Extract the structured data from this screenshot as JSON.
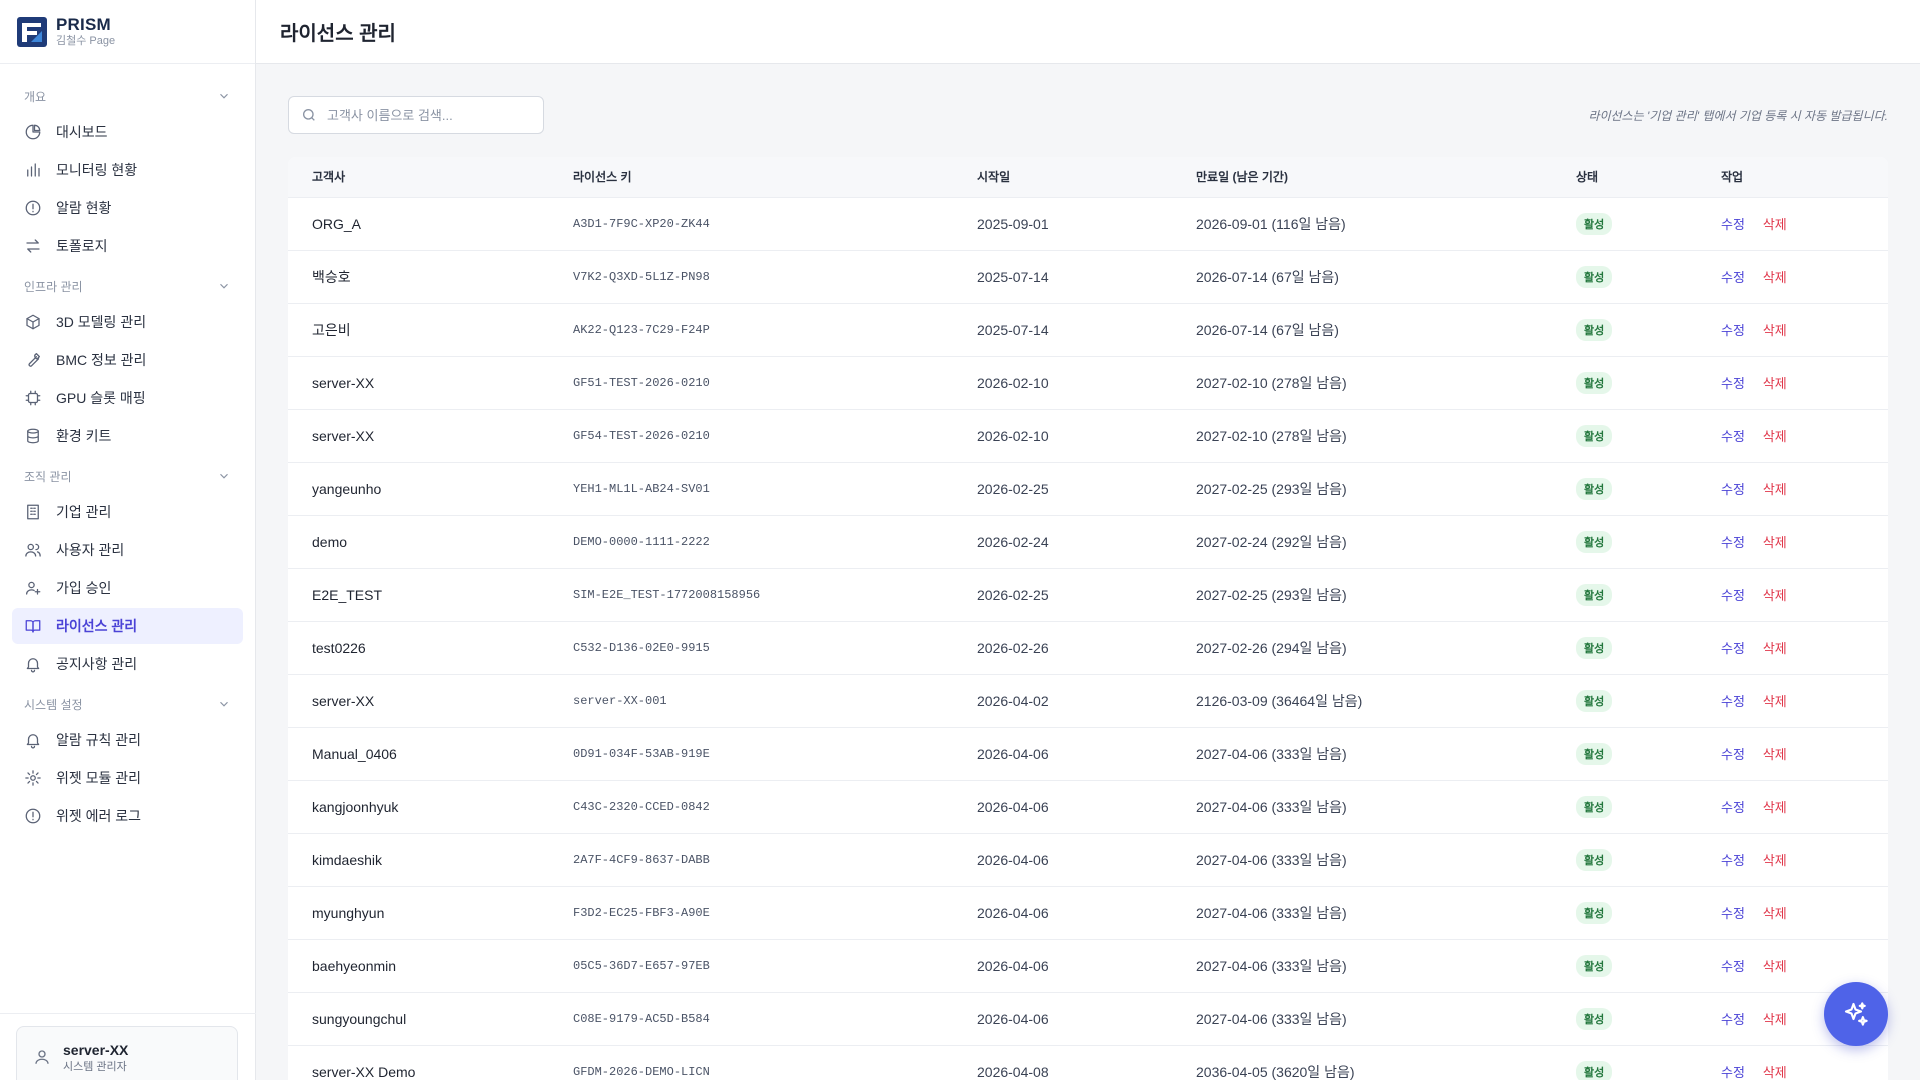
{
  "brand": {
    "name": "PRISM",
    "sub": "김철수 Page"
  },
  "header": {
    "title": "라이선스 관리"
  },
  "sidebar": {
    "sections": [
      {
        "label": "개요",
        "items": [
          {
            "label": "대시보드",
            "icon": "pie-chart-icon"
          },
          {
            "label": "모니터링 현황",
            "icon": "bar-chart-icon"
          },
          {
            "label": "알람 현황",
            "icon": "alert-circle-icon"
          },
          {
            "label": "토폴로지",
            "icon": "arrows-swap-icon"
          }
        ]
      },
      {
        "label": "인프라 관리",
        "items": [
          {
            "label": "3D 모델링 관리",
            "icon": "cube-icon"
          },
          {
            "label": "BMC 정보 관리",
            "icon": "wrench-icon"
          },
          {
            "label": "GPU 슬롯 매핑",
            "icon": "chip-icon"
          },
          {
            "label": "환경 키트",
            "icon": "database-icon"
          }
        ]
      },
      {
        "label": "조직 관리",
        "items": [
          {
            "label": "기업 관리",
            "icon": "building-icon"
          },
          {
            "label": "사용자 관리",
            "icon": "users-icon"
          },
          {
            "label": "가입 승인",
            "icon": "user-plus-icon"
          },
          {
            "label": "라이선스 관리",
            "icon": "book-open-icon",
            "active": true
          },
          {
            "label": "공지사항 관리",
            "icon": "bell-icon"
          }
        ]
      },
      {
        "label": "시스템 설정",
        "items": [
          {
            "label": "알람 규칙 관리",
            "icon": "bell-icon"
          },
          {
            "label": "위젯 모듈 관리",
            "icon": "gear-icon"
          },
          {
            "label": "위젯 에러 로그",
            "icon": "alert-circle-icon"
          }
        ]
      }
    ]
  },
  "user": {
    "name": "server-XX",
    "role": "시스템 관리자"
  },
  "search": {
    "placeholder": "고객사 이름으로 검색..."
  },
  "hint": "라이선스는 '기업 관리' 탭에서 기업 등록 시 자동 발급됩니다.",
  "table": {
    "headers": {
      "customer": "고객사",
      "key": "라이선스 키",
      "start": "시작일",
      "expiry": "만료일 (남은 기간)",
      "status": "상태",
      "action": "작업"
    },
    "edit_label": "수정",
    "delete_label": "삭제",
    "rows": [
      {
        "customer": "ORG_A",
        "key": "A3D1-7F9C-XP20-ZK44",
        "start": "2025-09-01",
        "expiry": "2026-09-01 (116일 남음)",
        "status": "활성"
      },
      {
        "customer": "백승호",
        "key": "V7K2-Q3XD-5L1Z-PN98",
        "start": "2025-07-14",
        "expiry": "2026-07-14 (67일 남음)",
        "status": "활성"
      },
      {
        "customer": "고은비",
        "key": "AK22-Q123-7C29-F24P",
        "start": "2025-07-14",
        "expiry": "2026-07-14 (67일 남음)",
        "status": "활성"
      },
      {
        "customer": "server-XX",
        "key": "GF51-TEST-2026-0210",
        "start": "2026-02-10",
        "expiry": "2027-02-10 (278일 남음)",
        "status": "활성"
      },
      {
        "customer": "server-XX",
        "key": "GF54-TEST-2026-0210",
        "start": "2026-02-10",
        "expiry": "2027-02-10 (278일 남음)",
        "status": "활성"
      },
      {
        "customer": "yangeunho",
        "key": "YEH1-ML1L-AB24-SV01",
        "start": "2026-02-25",
        "expiry": "2027-02-25 (293일 남음)",
        "status": "활성"
      },
      {
        "customer": "demo",
        "key": "DEMO-0000-1111-2222",
        "start": "2026-02-24",
        "expiry": "2027-02-24 (292일 남음)",
        "status": "활성"
      },
      {
        "customer": "E2E_TEST",
        "key": "SIM-E2E_TEST-1772008158956",
        "start": "2026-02-25",
        "expiry": "2027-02-25 (293일 남음)",
        "status": "활성"
      },
      {
        "customer": "test0226",
        "key": "C532-D136-02E0-9915",
        "start": "2026-02-26",
        "expiry": "2027-02-26 (294일 남음)",
        "status": "활성"
      },
      {
        "customer": "server-XX",
        "key": "server-XX-001",
        "start": "2026-04-02",
        "expiry": "2126-03-09 (36464일 남음)",
        "status": "활성"
      },
      {
        "customer": "Manual_0406",
        "key": "0D91-034F-53AB-919E",
        "start": "2026-04-06",
        "expiry": "2027-04-06 (333일 남음)",
        "status": "활성"
      },
      {
        "customer": "kangjoonhyuk",
        "key": "C43C-2320-CCED-0842",
        "start": "2026-04-06",
        "expiry": "2027-04-06 (333일 남음)",
        "status": "활성"
      },
      {
        "customer": "kimdaeshik",
        "key": "2A7F-4CF9-8637-DABB",
        "start": "2026-04-06",
        "expiry": "2027-04-06 (333일 남음)",
        "status": "활성"
      },
      {
        "customer": "myunghyun",
        "key": "F3D2-EC25-FBF3-A90E",
        "start": "2026-04-06",
        "expiry": "2027-04-06 (333일 남음)",
        "status": "활성"
      },
      {
        "customer": "baehyeonmin",
        "key": "05C5-36D7-E657-97EB",
        "start": "2026-04-06",
        "expiry": "2027-04-06 (333일 남음)",
        "status": "활성"
      },
      {
        "customer": "sungyoungchul",
        "key": "C08E-9179-AC5D-B584",
        "start": "2026-04-06",
        "expiry": "2027-04-06 (333일 남음)",
        "status": "활성"
      },
      {
        "customer": "server-XX Demo",
        "key": "GFDM-2026-DEMO-LICN",
        "start": "2026-04-08",
        "expiry": "2036-04-05 (3620일 남음)",
        "status": "활성"
      }
    ]
  },
  "fab": {
    "icon": "sparkles-icon"
  },
  "colors": {
    "accent": "#4b43d6",
    "danger": "#e0364a",
    "success_bg": "#e5f7ea",
    "success_text": "#23773d",
    "fab": "#4f63e8"
  }
}
